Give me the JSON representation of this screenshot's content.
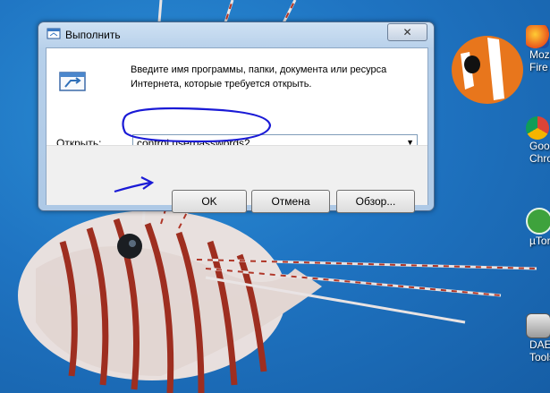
{
  "dialog": {
    "title": "Выполнить",
    "close_label": "✕",
    "description": "Введите имя программы, папки, документа или ресурса Интернета, которые требуется открыть.",
    "open_label": "Открыть:",
    "command_value": "control userpasswords2",
    "ok_label": "OK",
    "cancel_label": "Отмена",
    "browse_label": "Обзор..."
  },
  "desktop": {
    "icons": [
      {
        "label": "Mozi",
        "sublabel": "Fire",
        "icon": "firefox-icon"
      },
      {
        "label": "Goo",
        "sublabel": "Chro",
        "icon": "chrome-icon"
      },
      {
        "label": "µTor",
        "icon": "utorrent-icon"
      },
      {
        "label": "DAE",
        "sublabel": "Tools",
        "icon": "daemon-tools-icon"
      }
    ]
  },
  "colors": {
    "desktop_blue": "#1f74c2",
    "annotation_blue": "#1a1ad6",
    "dialog_frame": "#b7d0ea"
  }
}
